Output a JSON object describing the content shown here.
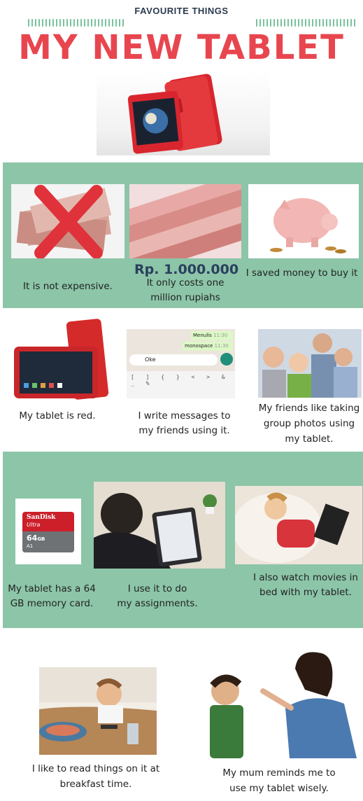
{
  "header": {
    "subtitle": "FAVOURITE THINGS",
    "title": "MY NEW TABLET"
  },
  "colors": {
    "title_red": "#e8464f",
    "band_green": "#8cc5a8",
    "subtitle_navy": "#2a3a4e",
    "price_navy": "#2a3f5e"
  },
  "sections": {
    "s1": {
      "cap_price": "It is not expensive.",
      "price_tag": "Rp. 1.000.000",
      "cap_cost_1": "It only costs one",
      "cap_cost_2": "million rupiahs",
      "cap_saved": "I saved money to buy it"
    },
    "s2": {
      "cap_red": "My tablet is red.",
      "cap_msg_1": "I write messages to",
      "cap_msg_2": "my friends using it.",
      "cap_friends_1": "My friends like taking",
      "cap_friends_2": "group photos using",
      "cap_friends_3": "my tablet.",
      "chat_bubble_1": "Menulis",
      "chat_time_1": "11:30",
      "chat_bubble_2": "monospace",
      "chat_time_2": "11:30",
      "chat_input": "Oke"
    },
    "s3": {
      "cap_card_1": "My tablet has a 64",
      "cap_card_2": "GB memory card.",
      "card_brand": "SanDisk",
      "card_line": "Ultra",
      "card_capacity": "64",
      "card_unit": "GB",
      "card_class": "A1",
      "cap_assign_1": "I use it to do",
      "cap_assign_2": "my assignments.",
      "cap_movies_1": "I also watch movies in",
      "cap_movies_2": "bed with my tablet."
    },
    "s4": {
      "cap_breakfast_1": "I like to read things on it at",
      "cap_breakfast_2": "breakfast time.",
      "cap_mum_1": "My mum reminds me to",
      "cap_mum_2": "use my tablet wisely."
    }
  }
}
